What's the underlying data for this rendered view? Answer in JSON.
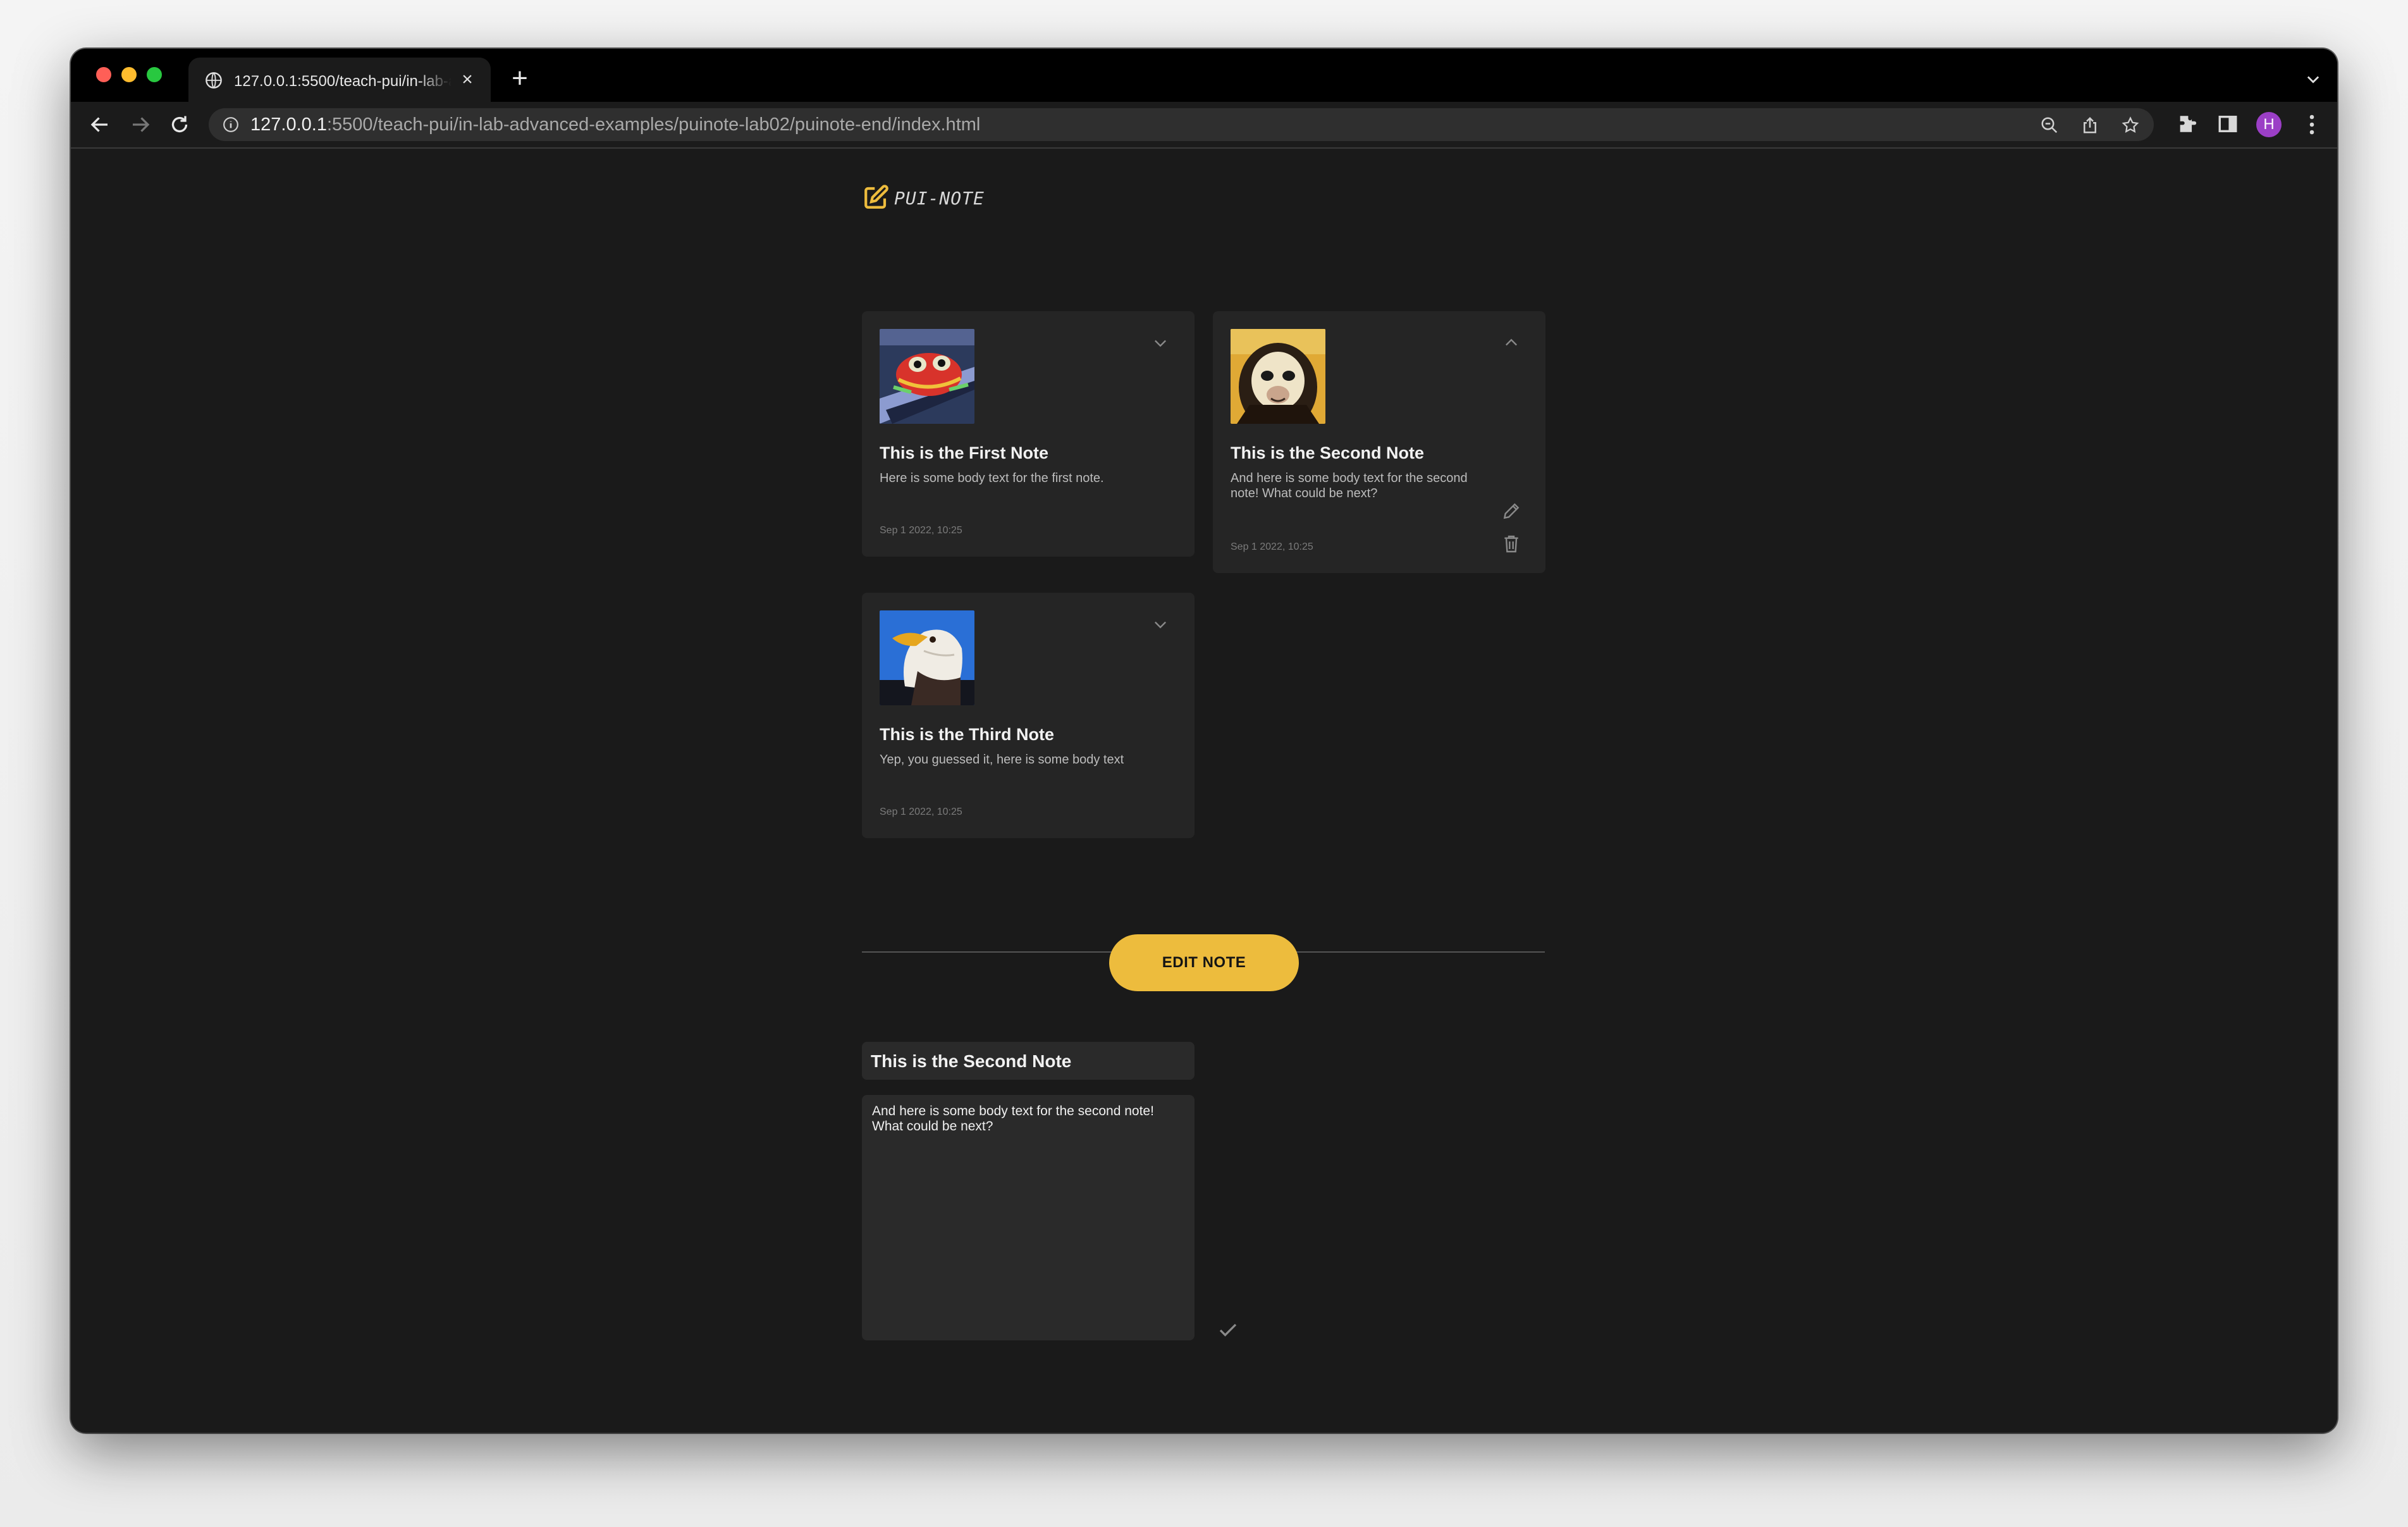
{
  "browser": {
    "tab_title": "127.0.0.1:5500/teach-pui/in-lab-advanced-examples/puinote-lab02/puinote-end/index.html",
    "new_tab_label": "+",
    "url_host": "127.0.0.1",
    "url_path": ":5500/teach-pui/in-lab-advanced-examples/puinote-lab02/puinote-end/index.html",
    "profile_initial": "H",
    "profile_color": "#9b3fc6"
  },
  "app": {
    "logo_text": "PUI-NOTE",
    "accent_color": "#edbc3d"
  },
  "notes": [
    {
      "title": "This is the First Note",
      "body": "Here is some body text for the first note.",
      "date": "Sep 1 2022, 10:25",
      "image": "frog-artwork",
      "expanded": false
    },
    {
      "title": "This is the Second Note",
      "body": "And here is some body text for the second note! What could be next?",
      "date": "Sep 1 2022, 10:25",
      "image": "orangutan-artwork",
      "expanded": true
    },
    {
      "title": "This is the Third Note",
      "body": "Yep, you guessed it, here is some body text",
      "date": "Sep 1 2022, 10:25",
      "image": "eagle-artwork",
      "expanded": false
    }
  ],
  "editor": {
    "heading_button": "EDIT NOTE",
    "title_value": "This is the Second Note",
    "body_value": "And here is some body text for the second note!\nWhat could be next?"
  }
}
